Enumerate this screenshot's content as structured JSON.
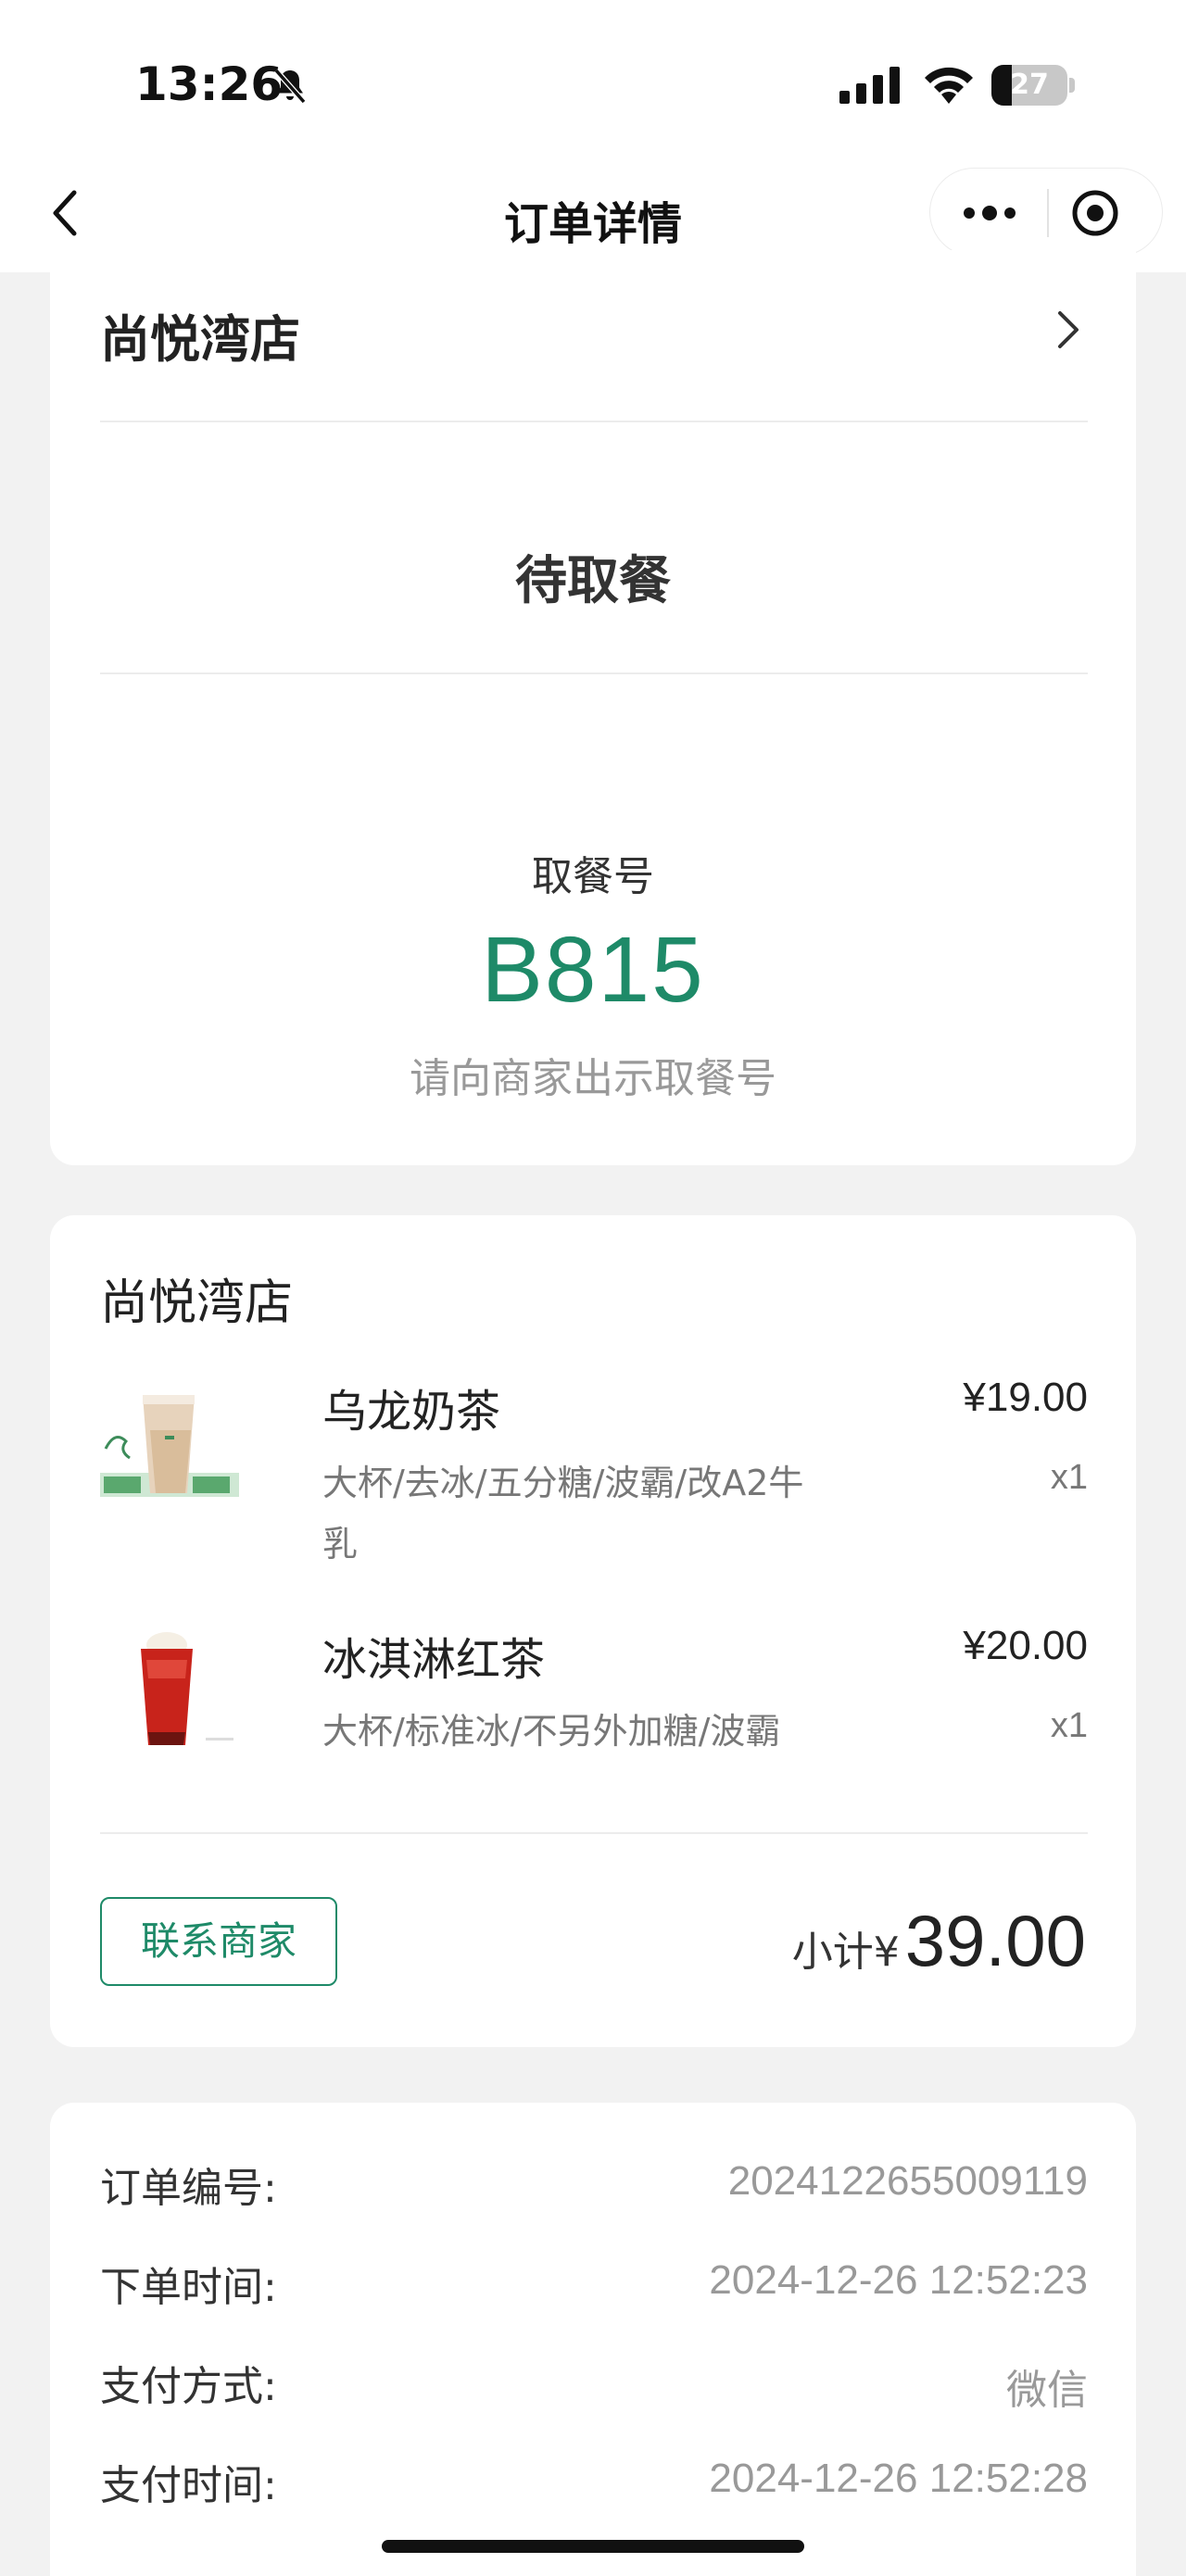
{
  "status_bar": {
    "time": "13:26",
    "battery": "27",
    "battery_level": 0.27,
    "icons": [
      "bell-off-icon",
      "signal-icon",
      "wifi-icon",
      "battery-icon"
    ]
  },
  "nav": {
    "title": "订单详情",
    "icons": [
      "back-icon",
      "more-icon",
      "close-icon"
    ]
  },
  "order_status": {
    "store_name": "尚悦湾店",
    "status": "待取餐",
    "pickup_label": "取餐号",
    "pickup_number": "B815",
    "pickup_hint": "请向商家出示取餐号"
  },
  "order_items": {
    "store_name": "尚悦湾店",
    "items": [
      {
        "name": "乌龙奶茶",
        "spec": "大杯/去冰/五分糖/波霸/改A2牛乳",
        "price": "¥19.00",
        "qty": "x1"
      },
      {
        "name": "冰淇淋红茶",
        "spec": "大杯/标准冰/不另外加糖/波霸",
        "price": "¥20.00",
        "qty": "x1"
      }
    ],
    "contact_button": "联系商家",
    "subtotal_label": "小计¥",
    "subtotal_value": "39.00"
  },
  "order_info": {
    "rows": [
      {
        "label": "订单编号:",
        "value": "2024122655009119"
      },
      {
        "label": "下单时间:",
        "value": "2024-12-26 12:52:23"
      },
      {
        "label": "支付方式:",
        "value": "微信"
      },
      {
        "label": "支付时间:",
        "value": "2024-12-26 12:52:28"
      }
    ]
  },
  "colors": {
    "accent": "#1e8a68",
    "background": "#f2f2f2",
    "card": "#ffffff",
    "muted_text": "#999999"
  }
}
